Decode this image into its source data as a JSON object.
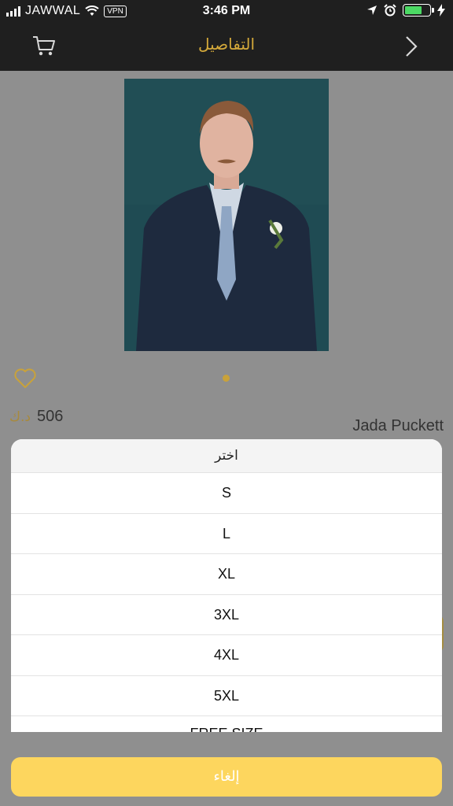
{
  "status_bar": {
    "carrier": "JAWWAL",
    "vpn": "VPN",
    "time": "3:46 PM"
  },
  "nav": {
    "title": "التفاصيل",
    "back_icon": "chevron-right-icon",
    "cart_icon": "cart-icon"
  },
  "product": {
    "price": "506",
    "currency": "د.ك",
    "seller": "Jada Puckett",
    "image_count": 1
  },
  "size_sheet": {
    "title": "اختر",
    "options": [
      "S",
      "L",
      "XL",
      "3XL",
      "4XL",
      "5XL",
      "FREE SIZE"
    ]
  },
  "cancel_label": "إلغاء",
  "colors": {
    "accent": "#d4a93a",
    "cancel_bg": "#fdd65e",
    "battery": "#4cd964"
  }
}
